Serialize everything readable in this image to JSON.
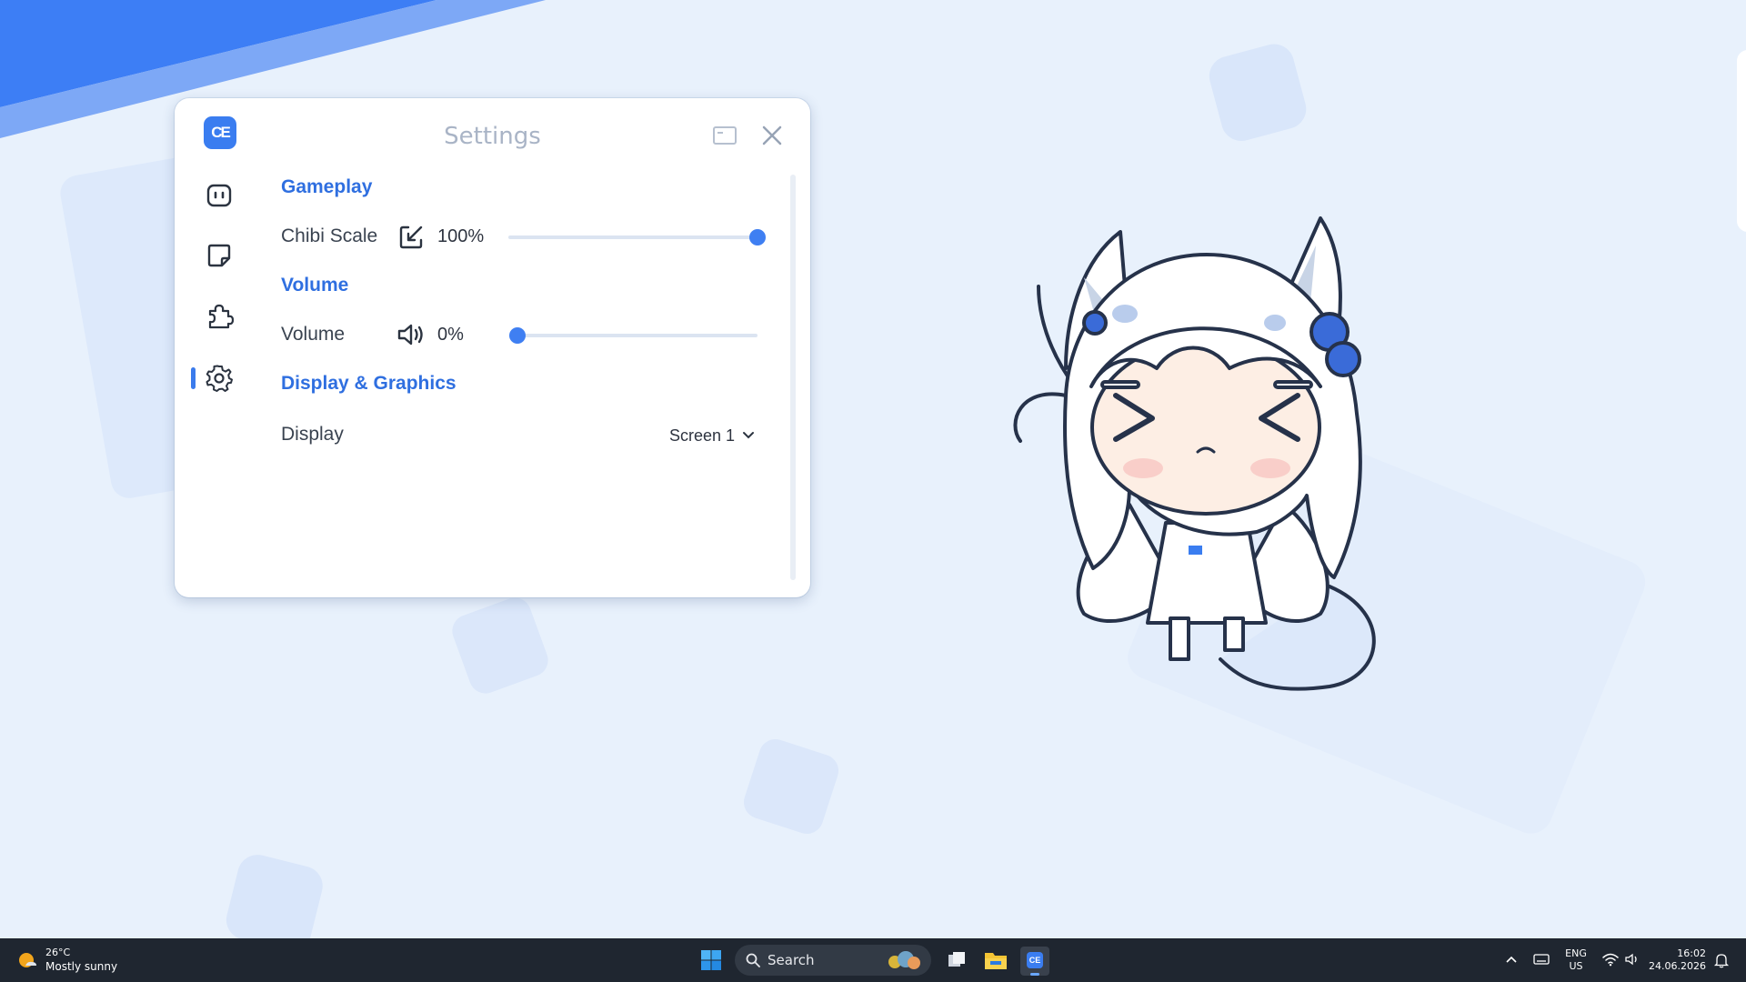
{
  "window": {
    "title": "Settings",
    "logo_text": "CE",
    "nav": [
      {
        "icon": "chat-icon",
        "active": false
      },
      {
        "icon": "sticky-note-icon",
        "active": false
      },
      {
        "icon": "puzzle-icon",
        "active": false
      },
      {
        "icon": "gear-icon",
        "active": true
      }
    ],
    "sections": {
      "gameplay": {
        "title": "Gameplay",
        "chibi_scale_label": "Chibi Scale",
        "chibi_scale_value": "100%",
        "chibi_scale_level": 1.0
      },
      "volume": {
        "title": "Volume",
        "volume_label": "Volume",
        "volume_value": "0%",
        "volume_level": 0.0
      },
      "display": {
        "title": "Display & Graphics",
        "display_label": "Display",
        "display_selected": "Screen 1"
      }
    }
  },
  "taskbar": {
    "weather_temp": "26°C",
    "weather_desc": "Mostly sunny",
    "search_placeholder": "Search",
    "language_top": "ENG",
    "language_bottom": "US",
    "time": "16:02",
    "date": "24.06.2026"
  },
  "colors": {
    "accent": "#3b7bec",
    "taskbar": "#1f2630",
    "desktop": "#e8f1fc"
  }
}
